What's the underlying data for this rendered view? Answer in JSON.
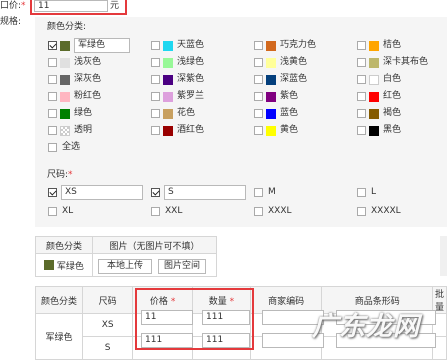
{
  "price_label": "口价:",
  "price_required": "*",
  "price_value": "11",
  "price_unit": "元",
  "spec_label": "规格:",
  "color_section_label": "颜色分类:",
  "colors": [
    {
      "name": "军绿色",
      "swatch": "#5b6b2a",
      "checked": true,
      "editing": true
    },
    {
      "name": "天蓝色",
      "swatch": "#1ed7f0",
      "checked": false
    },
    {
      "name": "巧克力色",
      "swatch": "#d2691e",
      "checked": false
    },
    {
      "name": "桔色",
      "swatch": "#ffa500",
      "checked": false
    },
    {
      "name": "浅灰色",
      "swatch": "#e0e0e0",
      "checked": false
    },
    {
      "name": "浅绿色",
      "swatch": "#98f898",
      "checked": false
    },
    {
      "name": "浅黄色",
      "swatch": "#ffff99",
      "checked": false
    },
    {
      "name": "深卡其布色",
      "swatch": "#bdb76b",
      "checked": false
    },
    {
      "name": "深灰色",
      "swatch": "#666666",
      "checked": false
    },
    {
      "name": "深紫色",
      "swatch": "#4b0082",
      "checked": false
    },
    {
      "name": "深蓝色",
      "swatch": "#043f7c",
      "checked": false
    },
    {
      "name": "白色",
      "swatch": "#ffffff",
      "checked": false
    },
    {
      "name": "粉红色",
      "swatch": "#ffb6c1",
      "checked": false
    },
    {
      "name": "紫罗兰",
      "swatch": "#dda0dd",
      "checked": false
    },
    {
      "name": "紫色",
      "swatch": "#800080",
      "checked": false
    },
    {
      "name": "红色",
      "swatch": "#ff0000",
      "checked": false
    },
    {
      "name": "绿色",
      "swatch": "#008000",
      "checked": false
    },
    {
      "name": "花色",
      "swatch": "#c8a060",
      "checked": false
    },
    {
      "name": "蓝色",
      "swatch": "#0000ff",
      "checked": false
    },
    {
      "name": "褐色",
      "swatch": "#855b00",
      "checked": false
    },
    {
      "name": "透明",
      "swatch": "transparent",
      "checked": false
    },
    {
      "name": "酒红色",
      "swatch": "#990000",
      "checked": false
    },
    {
      "name": "黄色",
      "swatch": "#ffff00",
      "checked": false
    },
    {
      "name": "黑色",
      "swatch": "#000000",
      "checked": false
    }
  ],
  "select_all_label": "全选",
  "size_section_label": "尺码:",
  "size_required": "*",
  "sizes": [
    {
      "name": "XS",
      "checked": true,
      "editing": true
    },
    {
      "name": "S",
      "checked": true,
      "editing": true
    },
    {
      "name": "M",
      "checked": false
    },
    {
      "name": "L",
      "checked": false
    },
    {
      "name": "XL",
      "checked": false
    },
    {
      "name": "XXL",
      "checked": false
    },
    {
      "name": "XXXL",
      "checked": false
    },
    {
      "name": "XXXXL",
      "checked": false
    }
  ],
  "image_table": {
    "col1": "颜色分类",
    "col2": "图片（无图片可不填）",
    "row_color": "军绿色",
    "row_swatch": "#5b6b2a",
    "upload_local": "本地上传",
    "upload_space": "图片空间"
  },
  "sku_table": {
    "headers": [
      "颜色分类",
      "尺码",
      "价格",
      "数量",
      "商家编码",
      "商品条形码",
      "批量"
    ],
    "required_mark": "*",
    "color": "军绿色",
    "rows": [
      {
        "size": "XS",
        "price": "11",
        "qty": "111"
      },
      {
        "size": "S",
        "price": "111",
        "qty": "111"
      }
    ]
  },
  "watermark": "广东龙网",
  "colors_theme": {
    "accent_red": "#e4393c",
    "border": "#d6d6d6",
    "panel_bg": "#f5f5f5"
  }
}
